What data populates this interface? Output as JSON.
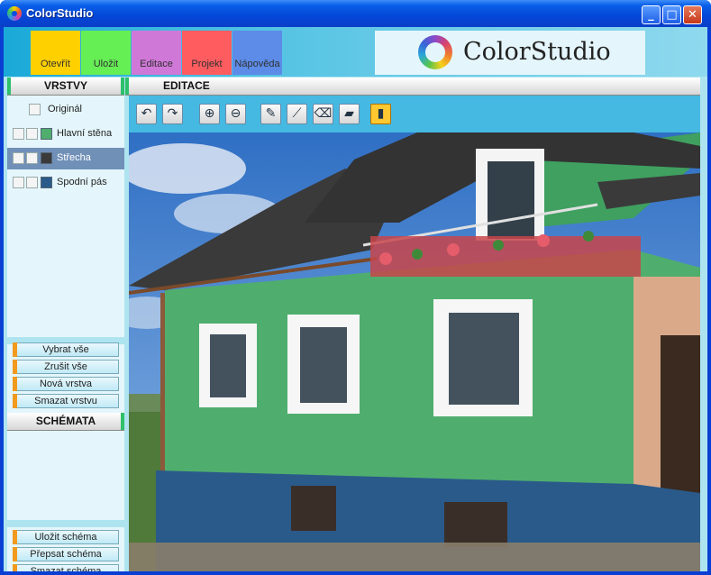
{
  "window": {
    "title": "ColorStudio",
    "buttons": [
      "minimize",
      "maximize",
      "close"
    ]
  },
  "menu": {
    "tabs": [
      {
        "label": "Otevřít",
        "color": "#ffd000"
      },
      {
        "label": "Uložit",
        "color": "#66ee55"
      },
      {
        "label": "Editace",
        "color": "#d078d8"
      },
      {
        "label": "Projekt",
        "color": "#ff5c60"
      },
      {
        "label": "Nápověda",
        "color": "#5c8ce8"
      }
    ],
    "logo_text": "ColorStudio"
  },
  "layers_panel": {
    "header": "VRSTVY",
    "layers": [
      {
        "name": "Originál",
        "color": "",
        "selected": false
      },
      {
        "name": "Hlavní stěna",
        "color": "#4fae6e",
        "selected": false
      },
      {
        "name": "Střecha",
        "color": "#3a3a3a",
        "selected": true
      },
      {
        "name": "Spodní pás",
        "color": "#2a5a8a",
        "selected": false
      }
    ],
    "buttons": [
      "Vybrat vše",
      "Zrušit vše",
      "Nová vrstva",
      "Smazat vrstvu"
    ]
  },
  "schemes_panel": {
    "header": "SCHÉMATA",
    "buttons": [
      "Uložit schéma",
      "Přepsat schéma",
      "Smazat schéma"
    ]
  },
  "editor": {
    "header": "EDITACE",
    "tools": [
      {
        "name": "undo-icon",
        "glyph": "↶"
      },
      {
        "name": "redo-icon",
        "glyph": "↷"
      },
      {
        "name": "zoom-in-icon",
        "glyph": "⊕"
      },
      {
        "name": "zoom-out-icon",
        "glyph": "⊖"
      },
      {
        "name": "pencil-icon",
        "glyph": "✎"
      },
      {
        "name": "polygon-icon",
        "glyph": "⟋"
      },
      {
        "name": "eraser-icon",
        "glyph": "⌫"
      },
      {
        "name": "bucket-icon",
        "glyph": "▰"
      },
      {
        "name": "palette-icon",
        "glyph": "▮"
      }
    ],
    "colors": {
      "wall": "#4fae6e",
      "roof": "#3a3a3a",
      "base": "#2a5a8a"
    }
  }
}
